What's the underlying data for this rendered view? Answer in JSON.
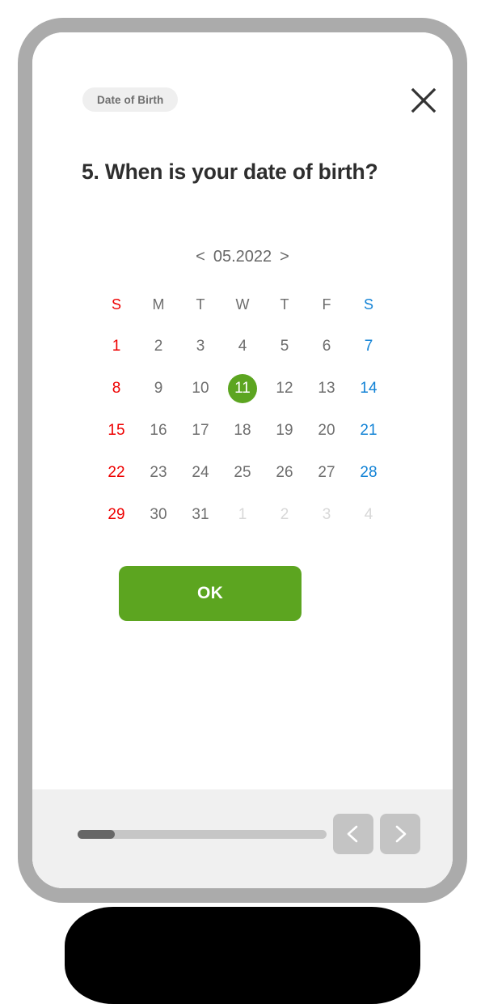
{
  "device": {
    "frame_color": "#ababab",
    "screen_background": "#ffffff"
  },
  "header": {
    "category_chip": "Date of Birth",
    "close_icon": "close-icon"
  },
  "question": {
    "title": "5. When is your date of birth?"
  },
  "calendar": {
    "prev_arrow": "<",
    "next_arrow": ">",
    "month_label": "05.2022",
    "weekdays": [
      "S",
      "M",
      "T",
      "W",
      "T",
      "F",
      "S"
    ],
    "selected_day": 11,
    "accent_color": "#5ca520",
    "sunday_color": "#ee0000",
    "saturday_color": "#1383d6",
    "weekday_color": "#6e6e6e",
    "muted_color": "#d8d8d8",
    "weeks": [
      [
        {
          "label": "1",
          "muted": false
        },
        {
          "label": "2",
          "muted": false
        },
        {
          "label": "3",
          "muted": false
        },
        {
          "label": "4",
          "muted": false
        },
        {
          "label": "5",
          "muted": false
        },
        {
          "label": "6",
          "muted": false
        },
        {
          "label": "7",
          "muted": false
        }
      ],
      [
        {
          "label": "8",
          "muted": false
        },
        {
          "label": "9",
          "muted": false
        },
        {
          "label": "10",
          "muted": false
        },
        {
          "label": "11",
          "muted": false,
          "selected": true
        },
        {
          "label": "12",
          "muted": false
        },
        {
          "label": "13",
          "muted": false
        },
        {
          "label": "14",
          "muted": false
        }
      ],
      [
        {
          "label": "15",
          "muted": false
        },
        {
          "label": "16",
          "muted": false
        },
        {
          "label": "17",
          "muted": false
        },
        {
          "label": "18",
          "muted": false
        },
        {
          "label": "19",
          "muted": false
        },
        {
          "label": "20",
          "muted": false
        },
        {
          "label": "21",
          "muted": false
        }
      ],
      [
        {
          "label": "22",
          "muted": false
        },
        {
          "label": "23",
          "muted": false
        },
        {
          "label": "24",
          "muted": false
        },
        {
          "label": "25",
          "muted": false
        },
        {
          "label": "26",
          "muted": false
        },
        {
          "label": "27",
          "muted": false
        },
        {
          "label": "28",
          "muted": false
        }
      ],
      [
        {
          "label": "29",
          "muted": false
        },
        {
          "label": "30",
          "muted": false
        },
        {
          "label": "31",
          "muted": false
        },
        {
          "label": "1",
          "muted": true
        },
        {
          "label": "2",
          "muted": true
        },
        {
          "label": "3",
          "muted": true
        },
        {
          "label": "4",
          "muted": true
        }
      ]
    ]
  },
  "actions": {
    "ok_label": "OK"
  },
  "bottom_bar": {
    "progress_percent": 15,
    "prev_icon": "chevron-left-icon",
    "next_icon": "chevron-right-icon"
  }
}
